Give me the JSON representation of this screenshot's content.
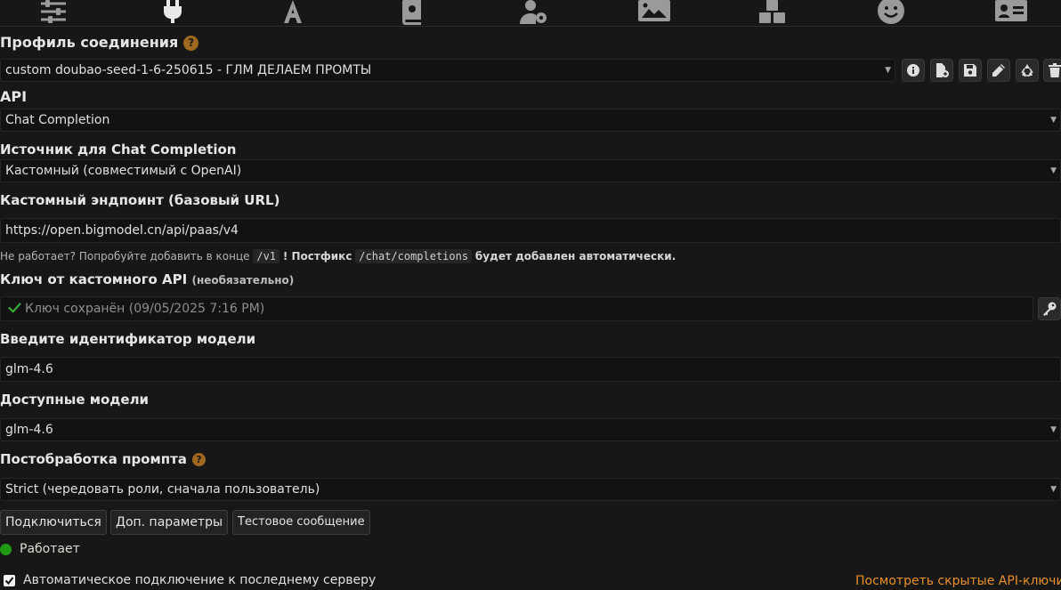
{
  "top_icons": [
    "sliders-icon",
    "plug-icon",
    "font-icon",
    "book-icon",
    "user-gear-icon",
    "image-icon",
    "cubes-icon",
    "smiley-icon",
    "id-card-icon"
  ],
  "connection_profile": {
    "title": "Профиль соединения",
    "help": "?",
    "selected": "custom doubao-seed-1-6-250615 - ГЛМ ДЕЛАЕМ ПРОМТЫ"
  },
  "api": {
    "label": "API",
    "selected": "Chat Completion"
  },
  "source": {
    "label": "Источник для Chat Completion",
    "selected": "Кастомный (совместимый с OpenAI)"
  },
  "endpoint": {
    "label": "Кастомный эндпоинт (базовый URL)",
    "value": "https://open.bigmodel.cn/api/paas/v4",
    "hint_part1": "Не работает? Попробуйте добавить в конце",
    "hint_code1": "/v1",
    "hint_part2": "! Постфикс",
    "hint_code2": "/chat/completions",
    "hint_part3": "будет добавлен автоматически."
  },
  "api_key": {
    "label": "Ключ от кастомного API",
    "optional": "(необязательно)",
    "saved_text": "Ключ сохранён (09/05/2025 7:16 PM)"
  },
  "model_id": {
    "label": "Введите идентификатор модели",
    "value": "glm-4.6"
  },
  "available_models": {
    "label": "Доступные модели",
    "selected": "glm-4.6"
  },
  "postprocessing": {
    "label": "Постобработка промпта",
    "help": "?",
    "selected": "Strict (чередовать роли, сначала пользователь)"
  },
  "buttons": {
    "connect": "Подключиться",
    "extra_params": "Доп. параметры",
    "test_message": "Тестовое сообщение"
  },
  "status": {
    "text": "Работает",
    "color": "#1f9a12"
  },
  "auto_connect": {
    "label": "Автоматическое подключение к последнему серверу",
    "checked": true
  },
  "hidden_keys_link": "Посмотреть скрытые API-ключи",
  "colors": {
    "background": "#171717",
    "accent_link": "#e8912a",
    "help_badge": "#a0681e"
  }
}
